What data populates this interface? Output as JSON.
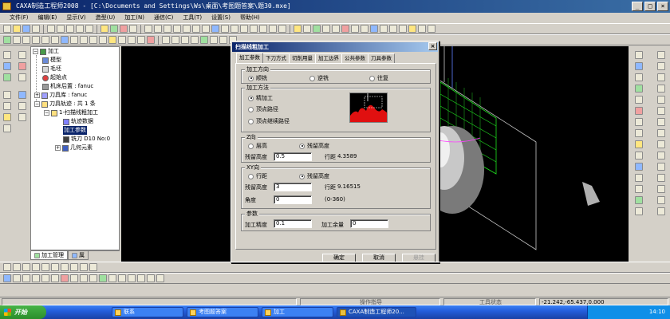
{
  "window": {
    "title": "CAXA制造工程师2008  - [C:\\Documents and Settings\\Ws\\桌面\\考图题答案\\题30.mxe]"
  },
  "menu": [
    {
      "label": "文件(F)"
    },
    {
      "label": "编辑(E)"
    },
    {
      "label": "显示(V)"
    },
    {
      "label": "造型(U)"
    },
    {
      "label": "加工(N)"
    },
    {
      "label": "通信(C)"
    },
    {
      "label": "工具(T)"
    },
    {
      "label": "设置(S)"
    },
    {
      "label": "帮助(H)"
    }
  ],
  "tree": {
    "root": "加工",
    "items": [
      {
        "label": "模型"
      },
      {
        "label": "毛坯"
      },
      {
        "label": "起始点"
      },
      {
        "label": "机床后置 : fanuc"
      },
      {
        "label": "刀具库 : fanuc"
      },
      {
        "label": "刀具轨迹 : 共 1 条"
      },
      {
        "label": "1-扫描线粗加工"
      },
      {
        "label": "轨迹数据"
      },
      {
        "label": "加工参数"
      },
      {
        "label": "铣刀 D10 No:0"
      },
      {
        "label": "几何元素"
      }
    ],
    "tabs": [
      {
        "label": "加工管理"
      },
      {
        "label": "属"
      }
    ]
  },
  "dialog": {
    "title": "扫描线粗加工",
    "tabs": [
      {
        "label": "加工参数"
      },
      {
        "label": "下刀方式"
      },
      {
        "label": "切削用量"
      },
      {
        "label": "加工边界"
      },
      {
        "label": "公共参数"
      },
      {
        "label": "刀具参数"
      }
    ],
    "direction": {
      "title": "加工方向",
      "options": [
        "顺铣",
        "逆铣",
        "往复"
      ],
      "selected": "顺铣"
    },
    "method": {
      "title": "加工方法",
      "options": [
        "精加工",
        "顶点路径",
        "顶点继续路径"
      ],
      "selected": "精加工"
    },
    "z_dir": {
      "title": "Z向",
      "options": [
        "层高",
        "残留高度"
      ],
      "selected": "残留高度",
      "residual_label": "残留高度",
      "residual_value": "0.5",
      "step_label": "行距",
      "step_value": "4.3589"
    },
    "xy_dir": {
      "title": "XY向",
      "options": [
        "行距",
        "残留高度"
      ],
      "selected": "残留高度",
      "residual_label": "残留高度",
      "residual_value": "3",
      "step_label": "行距",
      "step_value": "9.16515",
      "angle_label": "角度",
      "angle_value": "0",
      "angle_range": "(0-360)"
    },
    "params": {
      "title": "参数",
      "precision_label": "加工精度",
      "precision_value": "0.1",
      "allowance_label": "加工余量",
      "allowance_value": "0"
    },
    "buttons": {
      "ok": "确定",
      "cancel": "取消",
      "pause": "悬挂"
    }
  },
  "status": {
    "prompt": "操作指导",
    "tool_state": "工具状态",
    "coords": "-21.242,-65.437,0.000"
  },
  "taskbar": {
    "start": "开始",
    "tasks": [
      {
        "label": "联系"
      },
      {
        "label": "考图题答案"
      },
      {
        "label": "加工"
      },
      {
        "label": "CAXA制造工程师20..."
      }
    ],
    "clock": "14:10"
  },
  "colors": {
    "titlebar": "#0a246a",
    "viewport_bg": "#000000",
    "taskbar": "#245edc"
  }
}
